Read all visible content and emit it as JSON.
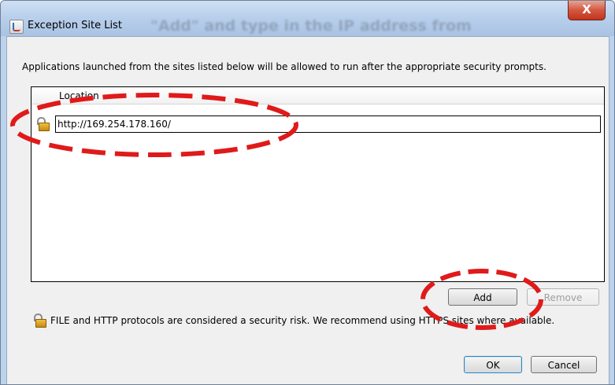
{
  "window": {
    "title": "Exception Site List",
    "background_caption": "\"Add\" and type in the IP address from",
    "close_glyph": "X"
  },
  "description": "Applications launched from the sites listed below will be allowed to run after the appropriate security prompts.",
  "table": {
    "column_header": "Location",
    "rows": [
      {
        "url": "http://169.254.178.160/",
        "icon": "unlocked-padlock-icon"
      }
    ]
  },
  "buttons": {
    "add": "Add",
    "remove": "Remove",
    "ok": "OK",
    "cancel": "Cancel"
  },
  "warning": {
    "icon": "unlocked-padlock-icon",
    "text": "FILE and HTTP protocols are considered a security risk.  We recommend using HTTPS sites where available."
  },
  "colors": {
    "annotation": "#e01a1a",
    "close_button": "#c2331b",
    "titlebar": "#b9d0ec"
  }
}
